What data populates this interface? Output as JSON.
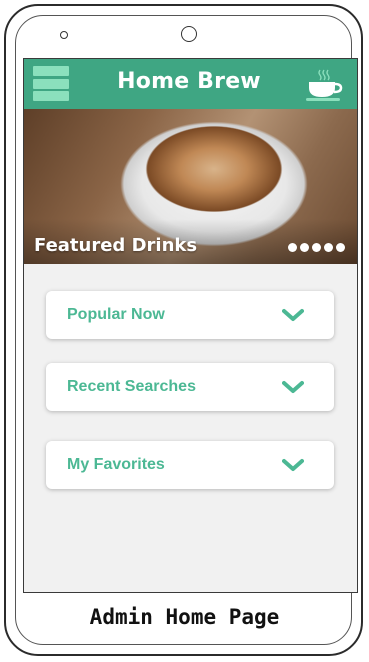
{
  "header": {
    "title": "Home Brew",
    "menu_icon": "hamburger-menu-icon",
    "logo_icon": "coffee-cup-icon"
  },
  "hero": {
    "title": "Featured Drinks",
    "slide_count": 5
  },
  "sections": [
    {
      "label": "Popular Now",
      "icon": "chevron-down-icon"
    },
    {
      "label": "Recent Searches",
      "icon": "chevron-down-icon"
    },
    {
      "label": "My Favorites",
      "icon": "chevron-down-icon"
    }
  ],
  "caption": "Admin Home Page",
  "colors": {
    "accent": "#3fa683",
    "accent_light": "#8be0bd",
    "section_text": "#4cb894",
    "background": "#f1f1f1"
  }
}
